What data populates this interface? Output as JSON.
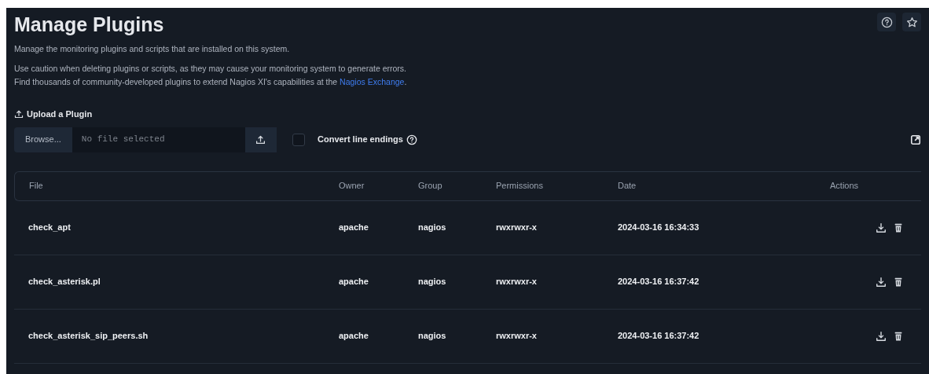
{
  "page": {
    "title": "Manage Plugins"
  },
  "intro": "Manage the monitoring plugins and scripts that are installed on this system.",
  "caution": [
    "Use caution when deleting plugins or scripts, as they may cause your monitoring system to generate errors.",
    "Find thousands of community-developed plugins to extend Nagios XI's capabilities at the "
  ],
  "exchange_link": "Nagios Exchange",
  "caution_end": ".",
  "upload": {
    "heading": "Upload a Plugin",
    "browse": "Browse...",
    "placeholder": "No file selected",
    "convert_label": "Convert line endings",
    "convert_checked": false
  },
  "table": {
    "columns": [
      "File",
      "Owner",
      "Group",
      "Permissions",
      "Date",
      "Actions"
    ],
    "rows": [
      {
        "file": "check_apt",
        "owner": "apache",
        "group": "nagios",
        "permissions": "rwxrwxr-x",
        "date": "2024-03-16 16:34:33"
      },
      {
        "file": "check_asterisk.pl",
        "owner": "apache",
        "group": "nagios",
        "permissions": "rwxrwxr-x",
        "date": "2024-03-16 16:37:42"
      },
      {
        "file": "check_asterisk_sip_peers.sh",
        "owner": "apache",
        "group": "nagios",
        "permissions": "rwxrwxr-x",
        "date": "2024-03-16 16:37:42"
      }
    ]
  }
}
